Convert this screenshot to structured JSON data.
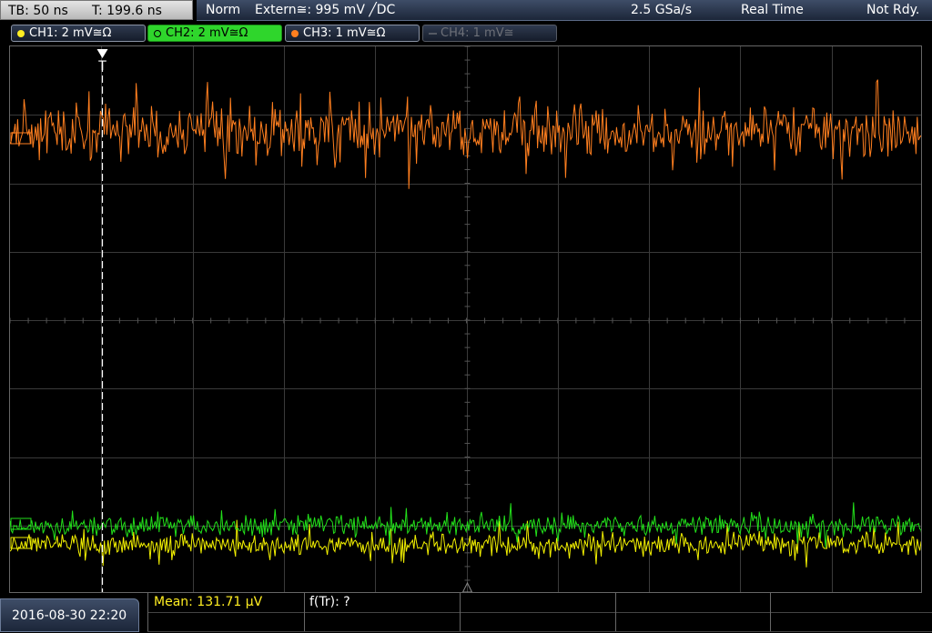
{
  "topbar": {
    "timebase": "TB: 50 ns",
    "trigger_time": "T: 199.6 ns",
    "trigger_mode": "Norm",
    "trigger_source": "Extern≅: 995 mV ╱DC",
    "sample_rate": "2.5 GSa/s",
    "acq_mode": "Real Time",
    "status": "Not Rdy."
  },
  "channels": [
    {
      "label": "CH1: 2 mV≅Ω",
      "color": "#ffee22",
      "state": "on"
    },
    {
      "label": "CH2: 2 mV≅Ω",
      "color": "#2fd62c",
      "state": "active"
    },
    {
      "label": "CH3: 1 mV≅Ω",
      "color": "#ff7f1f",
      "state": "on"
    },
    {
      "label": "CH4: 1 mV≅",
      "color": "#6d7078",
      "state": "off"
    }
  ],
  "screen": {
    "trigger_marker": "T",
    "waveform_colors": {
      "ch3": "#ff7f1f",
      "ch2": "#22e01a",
      "ch1": "#f2f000"
    }
  },
  "bottom": {
    "datetime": "2016-08-30 22:20",
    "meas_mean": "Mean: 131.71 µV",
    "meas_freq": "f(Tr): ?"
  }
}
